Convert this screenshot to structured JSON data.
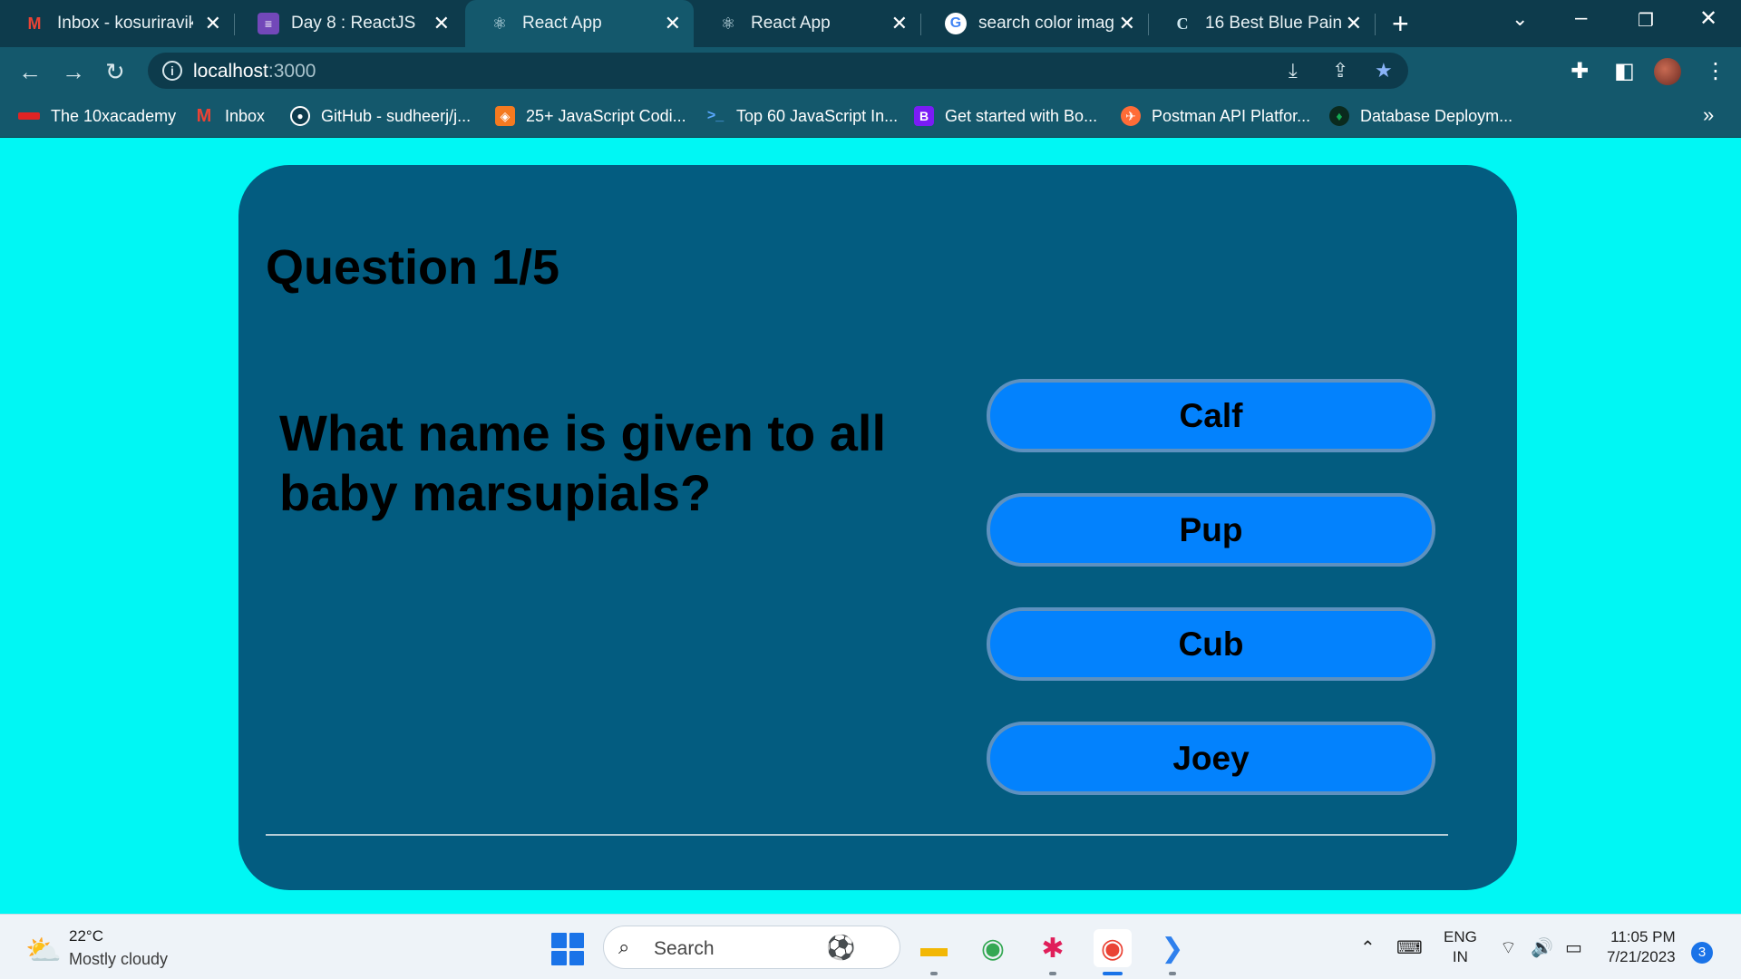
{
  "browser": {
    "tabs": [
      {
        "icon": "gmail-icon",
        "label": "Inbox - kosuriravika",
        "active": false
      },
      {
        "icon": "forms-icon",
        "label": "Day 8 : ReactJS",
        "active": false
      },
      {
        "icon": "react-icon",
        "label": "React App",
        "active": true
      },
      {
        "icon": "react-icon",
        "label": "React App",
        "active": false
      },
      {
        "icon": "google-icon",
        "label": "search color image",
        "active": false
      },
      {
        "icon": "canva-icon",
        "label": "16 Best Blue Paint C",
        "active": false
      }
    ],
    "address": {
      "host": "localhost",
      "port": ":3000"
    },
    "bookmarks": [
      {
        "icon": "10x-icon",
        "label": "The 10xacademy"
      },
      {
        "icon": "gmail-icon",
        "label": "Inbox"
      },
      {
        "icon": "github-icon",
        "label": "GitHub - sudheerj/j..."
      },
      {
        "icon": "js-icon",
        "label": "25+ JavaScript Codi..."
      },
      {
        "icon": "terminal-icon",
        "label": "Top 60 JavaScript In..."
      },
      {
        "icon": "bootstrap-icon",
        "label": "Get started with Bo..."
      },
      {
        "icon": "postman-icon",
        "label": "Postman API Platfor..."
      },
      {
        "icon": "mongodb-icon",
        "label": "Database Deploym..."
      }
    ]
  },
  "quiz": {
    "counter": "Question 1/5",
    "question": "What name is given to all baby marsupials?",
    "answers": [
      "Calf",
      "Pup",
      "Cub",
      "Joey"
    ]
  },
  "colors": {
    "page_background": "#00f7f4",
    "card_background": "#035c80",
    "answer_button": "#0382fd",
    "answer_border": "#5e91bf"
  },
  "taskbar": {
    "weather": {
      "temp": "22°C",
      "desc": "Mostly cloudy"
    },
    "search_label": "Search",
    "lang": {
      "line1": "ENG",
      "line2": "IN"
    },
    "clock": {
      "time": "11:05 PM",
      "date": "7/21/2023"
    },
    "notifications": "3"
  }
}
